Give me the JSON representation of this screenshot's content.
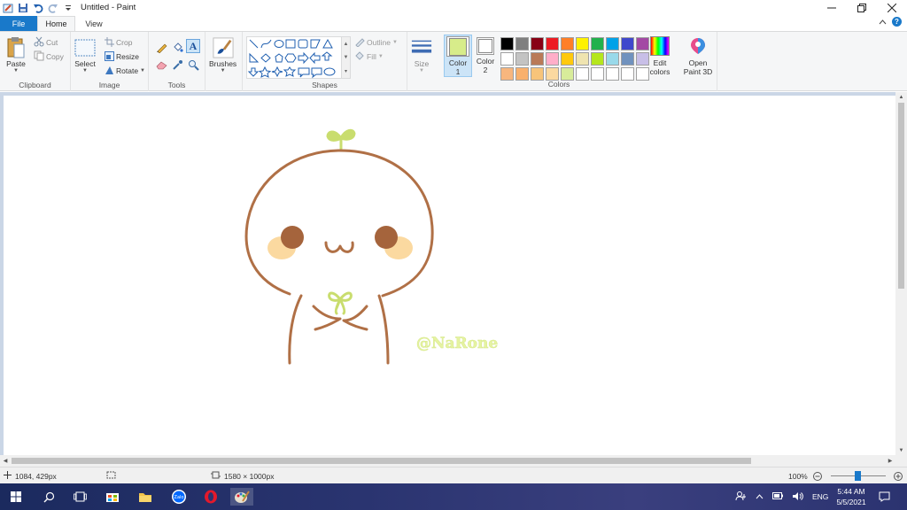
{
  "window": {
    "title": "Untitled - Paint"
  },
  "tabs": [
    {
      "label": "File"
    },
    {
      "label": "Home"
    },
    {
      "label": "View"
    }
  ],
  "ribbon": {
    "clipboard": {
      "label": "Clipboard",
      "paste": "Paste",
      "cut": "Cut",
      "copy": "Copy"
    },
    "image": {
      "label": "Image",
      "select": "Select",
      "crop": "Crop",
      "resize": "Resize",
      "rotate": "Rotate"
    },
    "tools": {
      "label": "Tools",
      "brushes": "Brushes"
    },
    "shapes": {
      "label": "Shapes",
      "outline": "Outline",
      "fill": "Fill"
    },
    "size": {
      "label": "Size"
    },
    "colors": {
      "label": "Colors",
      "color1": {
        "line1": "Color",
        "line2": "1",
        "value": "#d7ec8a"
      },
      "color2": {
        "line1": "Color",
        "line2": "2",
        "value": "#ffffff"
      },
      "edit_colors": {
        "line1": "Edit",
        "line2": "colors"
      },
      "open_paint3d": {
        "line1": "Open",
        "line2": "Paint 3D"
      },
      "palette": [
        "#000000",
        "#7f7f7f",
        "#880015",
        "#ed1c24",
        "#ff7f27",
        "#fff200",
        "#22b14c",
        "#00a2e8",
        "#3f48cc",
        "#a349a4",
        "#ffffff",
        "#c3c3c3",
        "#b97a57",
        "#ffaec9",
        "#ffc90e",
        "#efe4b0",
        "#b5e61d",
        "#99d9ea",
        "#7092be",
        "#c8bfe7",
        "#f7b67e",
        "#f9b06c",
        "#f7c47a",
        "#fbd9a0",
        "#d8ec9a",
        "#ffffff",
        "#ffffff",
        "#ffffff",
        "#ffffff",
        "#ffffff"
      ]
    }
  },
  "canvas": {
    "watermark": "@NaRone",
    "stroke_color": "#b07046",
    "cheek_color": "#fbd9a0",
    "eye_color": "#a5643c",
    "sprout_color": "#c9dd6e"
  },
  "status": {
    "cursor": "1084, 429px",
    "size": "1580 × 1000px",
    "zoom": "100%"
  },
  "taskbar": {
    "time": "5:44 AM",
    "date": "5/5/2021",
    "lang": "ENG",
    "apps": [
      "windows-start",
      "search",
      "task-view",
      "store",
      "file-explorer",
      "zalo",
      "opera",
      "paint"
    ]
  }
}
